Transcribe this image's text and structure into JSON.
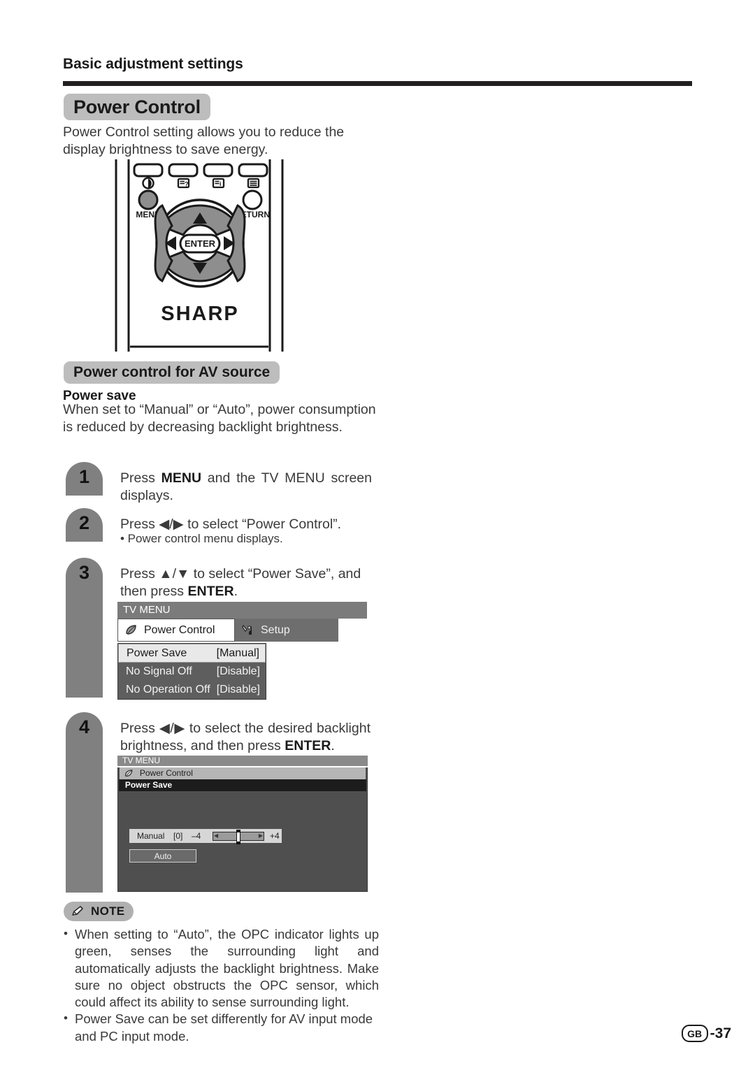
{
  "running_head": "Basic adjustment settings",
  "section": {
    "chip_title": "Power Control",
    "intro": "Power Control setting allows you to reduce the display brightness to save energy."
  },
  "remote": {
    "alt": "remote-control-illustration",
    "menu_label": "MENU",
    "return_label": "RETURN",
    "enter_label": "ENTER",
    "brand": "SHARP"
  },
  "av_section": {
    "chip_title": "Power control for AV source",
    "subtitle": "Power save",
    "body": "When set to “Manual” or “Auto”, power consumption is reduced by decreasing backlight brightness."
  },
  "steps": [
    {
      "number": "1",
      "text_html": "Press <b>MENU</b> and the TV MENU screen displays."
    },
    {
      "number": "2",
      "text_html": "Press ◀/▶ to select “Power Control”.",
      "sub": "• Power control menu displays."
    },
    {
      "number": "3",
      "text_html": "Press ▲/▼ to select “Power Save”, and then press <b>ENTER</b>."
    },
    {
      "number": "4",
      "text_html": "Press ◀/▶ to select the desired backlight brightness, and then press <b>ENTER</b>."
    }
  ],
  "osd_menu_1": {
    "title": "TV MENU",
    "tabs": [
      {
        "label": "Power Control",
        "icon": "leaf-icon",
        "active": true
      },
      {
        "label": "Setup",
        "icon": "wrench-icon",
        "active": false
      }
    ],
    "rows": [
      {
        "label": "Power Save",
        "value": "[Manual]",
        "selected": true
      },
      {
        "label": "No Signal Off",
        "value": "[Disable]",
        "selected": false
      },
      {
        "label": "No Operation Off",
        "value": "[Disable]",
        "selected": false
      }
    ]
  },
  "osd_menu_2": {
    "title": "TV MENU",
    "breadcrumb": "Power Control",
    "section_bar": "Power Save",
    "manual_label": "Manual",
    "manual_value": "[0]",
    "range_min": "–4",
    "range_max": "+4",
    "auto_label": "Auto"
  },
  "note": {
    "badge": "NOTE",
    "items": [
      "When setting to “Auto”, the OPC indicator lights up green, senses the surrounding light and automatically adjusts the backlight brightness. Make sure no object obstructs the OPC sensor, which could affect its ability to sense surrounding light.",
      "Power Save can be set differently for AV input mode and PC input mode."
    ]
  },
  "footer": {
    "region_mark": "GB",
    "page_number": "-37"
  },
  "colors": {
    "chip_bg": "#bdbdbd",
    "step_badge_bg": "#808080",
    "rule": "#231f20",
    "osd_title_bg": "#7b7b7b",
    "osd_list_bg": "#5e5e5e",
    "osd_selected_bg": "#e9e9e9"
  }
}
